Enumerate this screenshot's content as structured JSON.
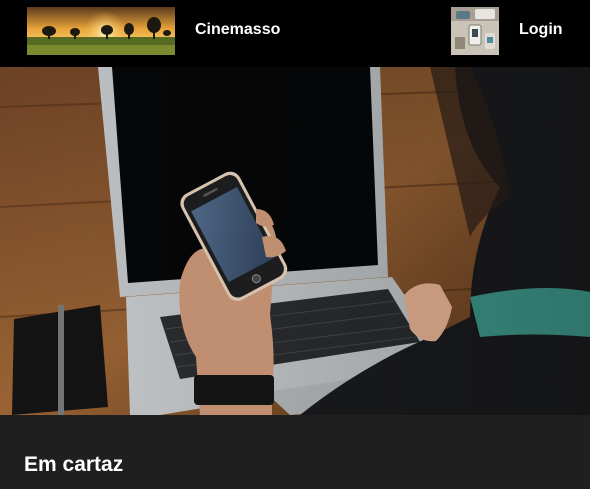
{
  "navbar": {
    "brand_name": "Cinemasso",
    "login_label": "Login",
    "brand_logo_icon": "sunset-field-photo",
    "login_thumb_icon": "desk-items-photo"
  },
  "hero": {
    "image_icon": "laptop-and-smartphone-photo"
  },
  "section": {
    "title": "Em cartaz"
  },
  "colors": {
    "navbar_bg": "#000000",
    "page_bg": "#1f1f20",
    "text": "#ffffff"
  }
}
